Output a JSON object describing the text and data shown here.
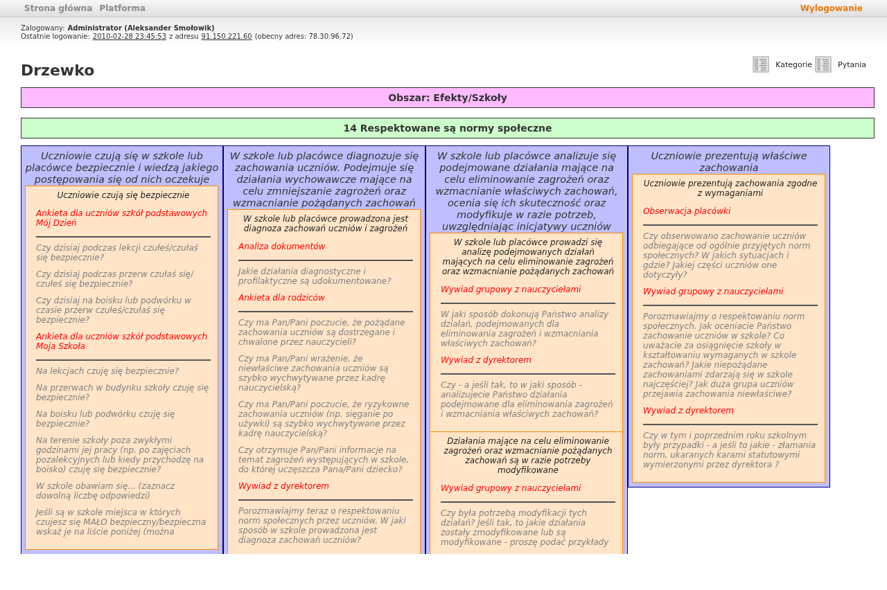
{
  "nav": {
    "items": [
      "Strona główna",
      "Platforma"
    ],
    "logout": "Wylogowanie"
  },
  "login": {
    "label": "Zalogowany:",
    "user": "Administrator (Aleksander Smołowik)",
    "last_label": "Ostatnie logowanie:",
    "last_date": "2010-02-28 23:45:53",
    "from_label": "z adresu",
    "last_ip": "91.150.221.60",
    "current": "(obecny adres: 78.30.96.72)"
  },
  "links": [
    "Kategorie",
    "Pytania"
  ],
  "title": "Drzewko",
  "bars": [
    {
      "kind": "area",
      "text": "Obszar: Efekty/Szkoły"
    },
    {
      "kind": "requirement",
      "text": "14 Respektowane są normy społeczne"
    }
  ],
  "columns": [
    {
      "title": "Uczniowie czują się w szkole lub placówce bezpiecznie i wiedzą jakiego postępowania się od nich oczekuje",
      "sections": [
        {
          "title": "Uczniowie czują się bezpiecznie",
          "groups": [
            {
              "tool": "Ankieta dla uczniów szkół podstawowych Mój Dzień",
              "questions": [
                "Czy dzisiaj podczas lekcji czułeś/czułaś się bezpiecznie?",
                "Czy dzisiaj podczas przerw czułaś się/ czułeś się bezpiecznie?",
                "Czy dzisiaj na boisku lub podwórku w czasie przerw czułeś/czułaś się bezpiecznie?"
              ]
            },
            {
              "tool": "Ankieta dla uczniów szkół podstawowych Moja Szkoła",
              "questions": [
                "Na lekcjach czuję się bezpiecznie?",
                "Na przerwach w budynku szkoły czuję się bezpiecznie?",
                "Na boisku lub podwórku czuję się bezpiecznie?",
                "Na terenie szkoły poza zwykłymi godzinami jej pracy (np. po zajęciach pozalekcyjnych lub kiedy przychodzę na boisko) czuję się bezpiecznie?",
                "W szkole obawiam się... (zaznacz dowolną liczbę odpowiedzi)",
                "Jeśli są w szkole miejsca w których czujesz się MAŁO bezpieczny/bezpieczna wskaż je na liście poniżej (można"
              ]
            }
          ]
        }
      ]
    },
    {
      "title": "W szkole lub placówce diagnozuje się zachowania uczniów. Podejmuje się działania wychowawcze mające na celu zmniejszanie zagrożeń oraz wzmacnianie pożądanych zachowań",
      "sections": [
        {
          "title": "W szkole lub placówce prowadzona jest diagnoza zachowań uczniów i zagrożeń",
          "groups": [
            {
              "tool": "Analiza dokumentów",
              "questions": [
                "Jakie działania diagnostyczne i profilaktyczne są udokumentowane?"
              ]
            },
            {
              "tool": "Ankieta dla rodziców",
              "questions": [
                "Czy ma Pan/Pani poczucie, że pożądane zachowania uczniów są dostrzegane i chwalone przez nauczycieli?",
                "Czy ma Pan/Pani wrażenie, że niewłaściwe zachowania uczniów są szybko wychwytywane przez kadrę nauczycielską?",
                "Czy ma Pan/Pani poczucie, że ryzykowne zachowania uczniów (np. sięganie po używki) są szybko wychwytywane przez kadrę nauczycielską?",
                "Czy otrzymuje Pan/Pani informacje na temat zagrożeń występujących w szkole, do której uczęszcza Pana/Pani dziecko?"
              ]
            },
            {
              "tool": "Wywiad z dyrektorem",
              "questions": [
                "Porozmawiajmy teraz o respektowaniu norm społecznych przez uczniów. W jaki sposób w szkole prowadzona jest diagnoza zachowań uczniów?"
              ]
            }
          ]
        }
      ]
    },
    {
      "title": "W szkole lub placówce analizuje się podejmowane działania mające na celu eliminowanie zagrożeń oraz wzmacnianie właściwych zachowań, ocenia się ich skuteczność oraz modyfikuje w razie potrzeb, uwzględniając inicjatywy uczniów",
      "sections": [
        {
          "title": "W szkole lub placówce prowadzi się analizę podejmowanych działań mających na celu eliminowanie zagrożeń oraz wzmacnianie pożądanych zachowań",
          "groups": [
            {
              "tool": "Wywiad grupowy z nauczycielami",
              "questions": [
                "W jaki sposób dokonują Państwo analizy działań, podejmowanych dla eliminowania zagrożeń i wzmacniania właściwych zachowań?"
              ]
            },
            {
              "tool": "Wywiad z dyrektorem",
              "questions": [
                "Czy - a jeśli tak, to w jaki sposób - analizujecie Państwo działania podejmowane dla eliminowania zagrożeń i wzmacniania właściwych zachowań?"
              ]
            }
          ]
        },
        {
          "title": "Działania mające na celu eliminowanie zagrożeń oraz wzmacnianie pożądanych zachowań są w razie potrzeby modyfikowane",
          "groups": [
            {
              "tool": "Wywiad grupowy z nauczycielami",
              "questions": [
                "Czy była potrzebą modyfikacji tych działań? Jeśli tak, to jakie działania zostały zmodyfikowane lub są modyfikowane - proszę podać przykłady"
              ]
            }
          ]
        }
      ]
    },
    {
      "title": "Uczniowie prezentują właściwe zachowania",
      "sections": [
        {
          "title": "Uczniowie prezentują zachowania zgodne z wymaganiami",
          "groups": [
            {
              "tool": "Obserwacja placówki",
              "questions": [
                "Czy obserwowano zachowanie uczniów odbiegające od ogólnie przyjętych norm społecznych? W jakich sytuacjach i gdzie? Jakiej części uczniów one dotyczyły?"
              ]
            },
            {
              "tool": "Wywiad grupowy z nauczycielami",
              "questions": [
                "Porozmawiajmy o respektowaniu norm społecznych. Jak oceniacie Państwo zachowanie uczniów w szkole? Co uważacie za osiągnięcie szkoły w kształtowaniu wymaganych w szkole zachowań? Jakie niepożądane zachowaniami zdarzają się w szkole najczęściej? Jak duża grupa uczniów przejawia zachowania niewłaściwe?"
              ]
            },
            {
              "tool": "Wywiad z dyrektorem",
              "questions": [
                "Czy w tym i poprzednim roku szkolnym były przypadki - a jeśli to jakie - złamania norm, ukaranych karami statutowymi wymierzonymi przez dyrektora ?"
              ]
            }
          ]
        }
      ]
    }
  ]
}
